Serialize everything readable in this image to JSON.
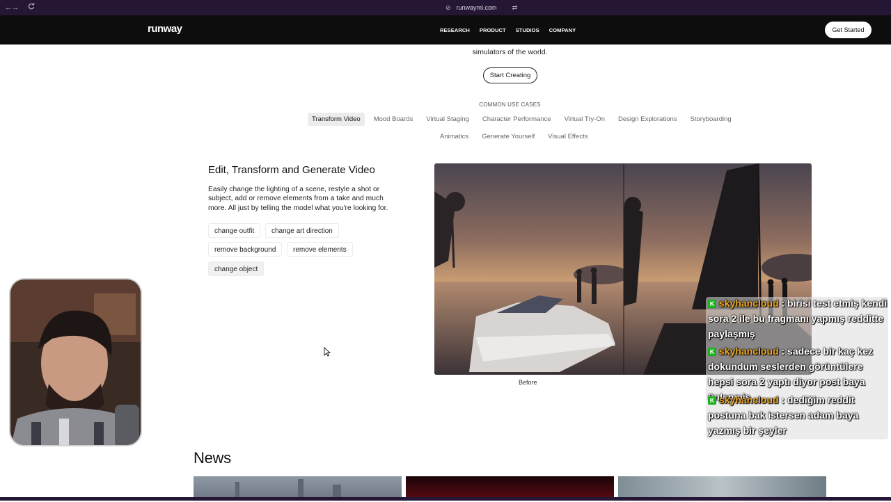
{
  "browser": {
    "url": "runwayml.com"
  },
  "header": {
    "logo": "runway",
    "menu": [
      "RESEARCH",
      "PRODUCT",
      "STUDIOS",
      "COMPANY"
    ],
    "cta": "Get Started"
  },
  "hero": {
    "subtitle_tail": "simulators of the world.",
    "start_button": "Start Creating"
  },
  "use_cases": {
    "title": "COMMON USE CASES",
    "row1": [
      "Transform Video",
      "Mood Boards",
      "Virtual Staging",
      "Character Performance",
      "Virtual Try-On",
      "Design Explorations",
      "Storyboarding"
    ],
    "row2": [
      "Animatics",
      "Generate Yourself",
      "Visual Effects"
    ],
    "active": "Transform Video"
  },
  "feature": {
    "title": "Edit, Transform and Generate Video",
    "description": "Easily change the lighting of a scene, restyle a shot or subject, add or remove elements from a take and much more. All just by telling the model what you're looking for.",
    "chips": [
      "change outfit",
      "change art direction",
      "remove background",
      "remove elements",
      "change object"
    ],
    "media_caption": "Before"
  },
  "news": {
    "title": "News"
  },
  "chat": {
    "messages": [
      {
        "user": "skyhancloud",
        "text": "birisi test etmiş kendi sora 2 ile bu fragmanı yapmış redditte paylaşmış"
      },
      {
        "user": "skyhancloud",
        "text": "sadece bir kaç kez dokundum seslerden görüntülere hepsi sora 2 yaptı diyor post baya ünlenmiş"
      },
      {
        "user": "skyhancloud",
        "text": "dediğim reddit postuna bak istersen adam baya yazmış bir şeyler"
      }
    ],
    "badge_letter": "K"
  },
  "colors": {
    "browser_bar": "#241634",
    "site_header": "#0d0d0d",
    "chat_user": "#f0a825",
    "chat_badge": "#1bb11b"
  },
  "icons": [
    "back-arrow-icon",
    "forward-arrow-icon",
    "reload-icon",
    "link-icon",
    "tune-icon",
    "cursor-icon",
    "chat-badge-icon"
  ]
}
